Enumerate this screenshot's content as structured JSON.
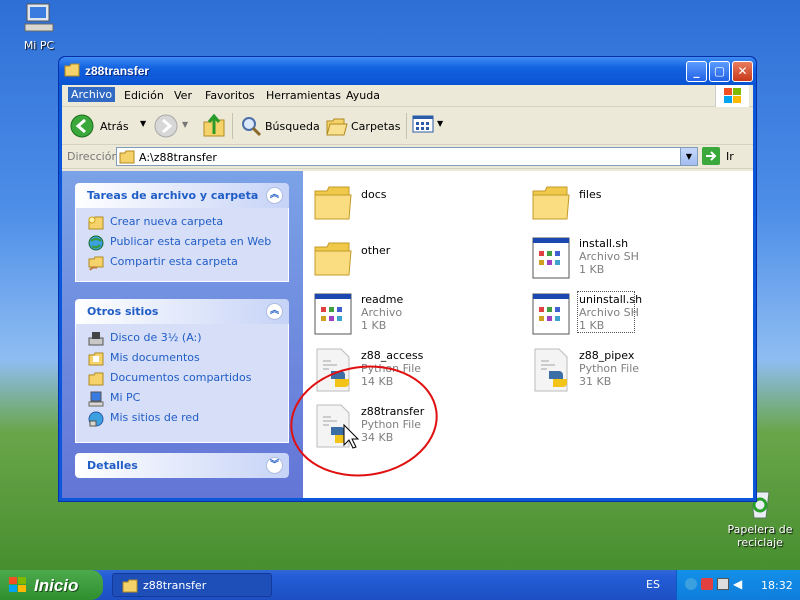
{
  "desktop": {
    "icons": [
      {
        "label": "Mi PC"
      },
      {
        "label": "Papelera de reciclaje"
      }
    ]
  },
  "window": {
    "title": "z88transfer",
    "menu": [
      "Archivo",
      "Edición",
      "Ver",
      "Favoritos",
      "Herramientas",
      "Ayuda"
    ],
    "toolbar": {
      "back": "Atrás",
      "search": "Búsqueda",
      "folders": "Carpetas"
    },
    "address": {
      "label": "Dirección",
      "value": "A:\\z88transfer",
      "go": "Ir"
    },
    "tasks": {
      "header": "Tareas de archivo y carpeta",
      "items": [
        "Crear nueva carpeta",
        "Publicar esta carpeta en Web",
        "Compartir esta carpeta"
      ]
    },
    "places": {
      "header": "Otros sitios",
      "items": [
        "Disco de 3½ (A:)",
        "Mis documentos",
        "Documentos compartidos",
        "Mi PC",
        "Mis sitios de red"
      ]
    },
    "details": {
      "header": "Detalles"
    },
    "files": [
      {
        "name": "docs",
        "type": "folder"
      },
      {
        "name": "files",
        "type": "folder"
      },
      {
        "name": "other",
        "type": "folder"
      },
      {
        "name": "install.sh",
        "kind": "Archivo SH",
        "size": "1 KB",
        "type": "doc"
      },
      {
        "name": "readme",
        "kind": "Archivo",
        "size": "1 KB",
        "type": "doc"
      },
      {
        "name": "uninstall.sh",
        "kind": "Archivo SH",
        "size": "1 KB",
        "type": "doc"
      },
      {
        "name": "z88_access",
        "kind": "Python File",
        "size": "14 KB",
        "type": "py"
      },
      {
        "name": "z88_pipex",
        "kind": "Python File",
        "size": "31 KB",
        "type": "py"
      },
      {
        "name": "z88transfer",
        "kind": "Python File",
        "size": "34 KB",
        "type": "py"
      }
    ]
  },
  "taskbar": {
    "start": "Inicio",
    "task": "z88transfer",
    "lang": "ES",
    "clock": "18:32"
  },
  "colors": {
    "xp_blue": "#0b56d9",
    "link_blue": "#215dc6",
    "annotation_red": "#e01010"
  }
}
